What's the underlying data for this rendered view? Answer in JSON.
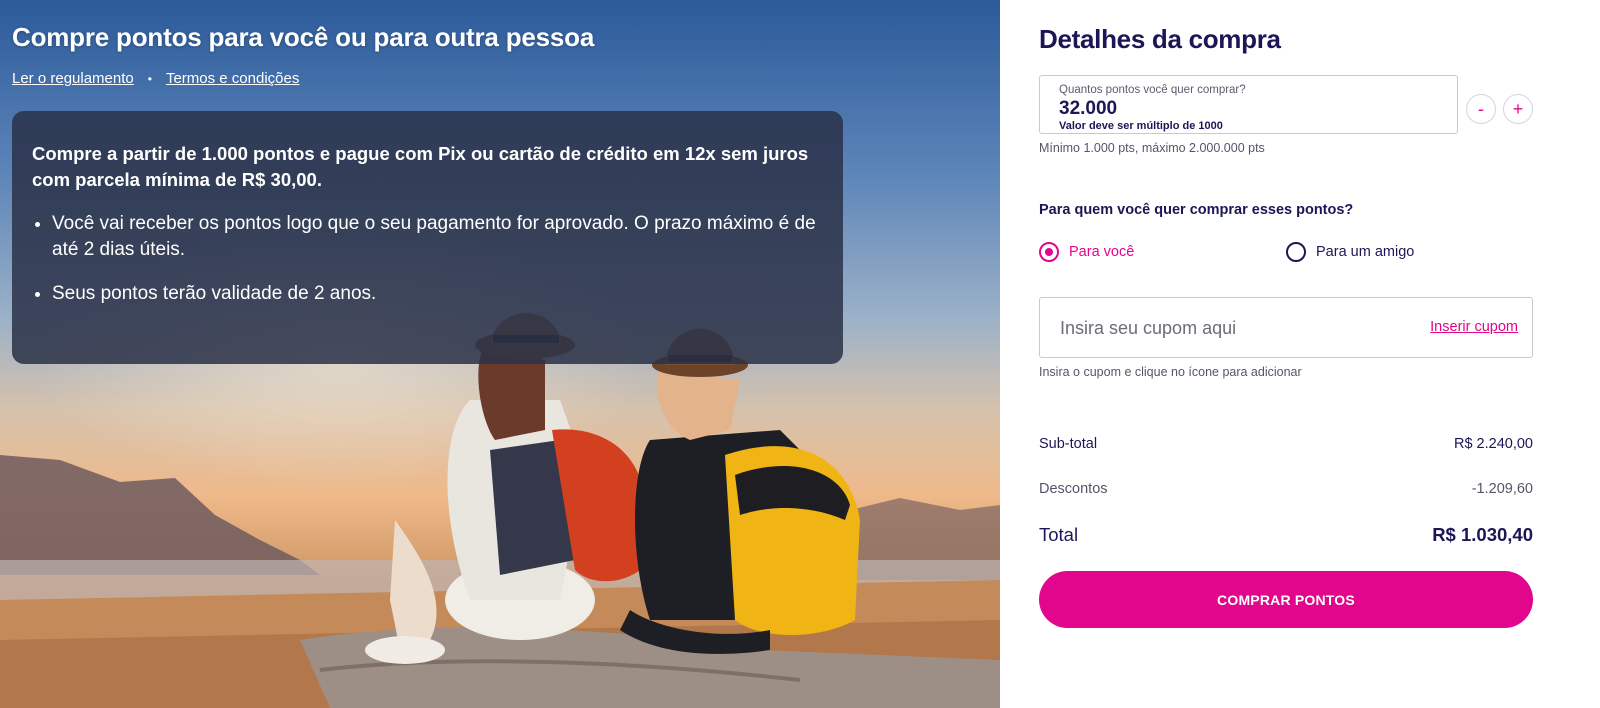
{
  "hero": {
    "title": "Compre pontos para você ou para outra pessoa",
    "links": {
      "rules": "Ler o regulamento",
      "separator": "•",
      "terms": "Termos e condições"
    },
    "card": {
      "lead": "Compre a partir de 1.000 pontos e pague com Pix ou cartão de crédito em 12x sem juros com parcela mínima de R$ 30,00.",
      "bullets": [
        "Você vai receber os pontos logo que o seu pagamento for aprovado. O prazo máximo é de até 2 dias úteis.",
        "Seus pontos terão validade de 2 anos."
      ]
    }
  },
  "panel": {
    "title": "Detalhes da compra",
    "points": {
      "label": "Quantos pontos você quer comprar?",
      "value": "32.000",
      "warning": "Valor deve ser múltiplo de 1000",
      "minus": "-",
      "plus": "+",
      "range_note": "Mínimo 1.000 pts, máximo 2.000.000 pts"
    },
    "recipient": {
      "question": "Para quem você quer comprar esses pontos?",
      "options": [
        {
          "label": "Para você",
          "selected": true
        },
        {
          "label": "Para um amigo",
          "selected": false
        }
      ]
    },
    "coupon": {
      "placeholder": "Insira seu cupom aqui",
      "action": "Inserir cupom",
      "hint": "Insira o cupom e clique no ícone para adicionar"
    },
    "summary": {
      "subtotal_label": "Sub-total",
      "subtotal_value": "R$ 2.240,00",
      "discount_label": "Descontos",
      "discount_value": "-1.209,60",
      "total_label": "Total",
      "total_value": "R$ 1.030,40"
    },
    "buy_button": "COMPRAR PONTOS"
  },
  "colors": {
    "brand_pink": "#e2068c",
    "navy": "#1b1757",
    "card_overlay": "#2b3248"
  }
}
